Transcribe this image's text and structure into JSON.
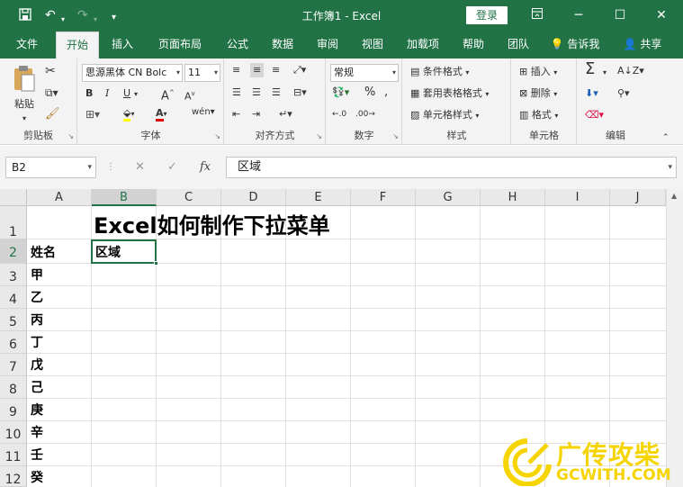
{
  "titlebar": {
    "title": "工作簿1  -  Excel",
    "login_label": "登录",
    "save_icon": "save-icon",
    "undo_icon": "undo-icon",
    "redo_icon": "redo-icon",
    "customize_icon": "customize-qat-icon"
  },
  "tabs": [
    {
      "label": "文件"
    },
    {
      "label": "开始"
    },
    {
      "label": "插入"
    },
    {
      "label": "页面布局"
    },
    {
      "label": "公式"
    },
    {
      "label": "数据"
    },
    {
      "label": "审阅"
    },
    {
      "label": "视图"
    },
    {
      "label": "加载项"
    },
    {
      "label": "帮助"
    },
    {
      "label": "团队"
    },
    {
      "label": "告诉我"
    },
    {
      "label": "共享"
    }
  ],
  "ribbon": {
    "clipboard": {
      "paste_label": "粘贴",
      "group_label": "剪贴板"
    },
    "font": {
      "font_name": "思源黑体 CN Bolc",
      "font_size": "11",
      "group_label": "字体"
    },
    "alignment": {
      "group_label": "对齐方式"
    },
    "number": {
      "format": "常规",
      "group_label": "数字"
    },
    "styles": {
      "conditional_label": "条件格式",
      "table_label": "套用表格格式",
      "cell_styles_label": "单元格样式",
      "group_label": "样式"
    },
    "cells": {
      "insert_label": "插入",
      "delete_label": "删除",
      "format_label": "格式",
      "group_label": "单元格"
    },
    "editing": {
      "group_label": "编辑"
    }
  },
  "formula_bar": {
    "name_box": "B2",
    "formula": "区域"
  },
  "sheet": {
    "columns": [
      "A",
      "B",
      "C",
      "D",
      "E",
      "F",
      "G",
      "H",
      "I",
      "J"
    ],
    "rows": [
      "1",
      "2",
      "3",
      "4",
      "5",
      "6",
      "7",
      "8",
      "9",
      "10",
      "11",
      "12"
    ],
    "selected_cell": "B2",
    "title": "Excel如何制作下拉菜单",
    "a2": "姓名",
    "b2": "区域",
    "names": [
      "甲",
      "乙",
      "丙",
      "丁",
      "戊",
      "己",
      "庚",
      "辛",
      "壬",
      "癸"
    ]
  },
  "watermark": {
    "text": "广传攻柴",
    "url": "GCWITH.COM"
  },
  "colors": {
    "accent": "#217346",
    "watermark": "#f5d400"
  }
}
